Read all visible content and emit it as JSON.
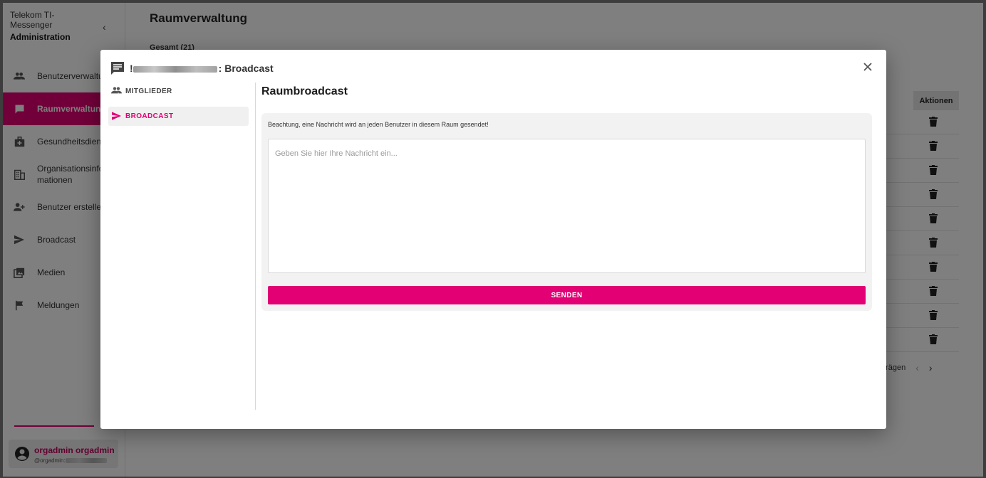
{
  "app": {
    "brand_line1": "Telekom TI-",
    "brand_line2": "Messenger",
    "brand_line3": "Administration"
  },
  "sidebar": {
    "items": [
      {
        "label": "Benutzerverwaltung",
        "icon": "people-icon",
        "active": false
      },
      {
        "label": "Raumverwaltung",
        "icon": "chat-icon",
        "active": true
      },
      {
        "label": "Gesundheitsdienste",
        "icon": "medical-bag-icon",
        "active": false
      },
      {
        "label": "Organisationsinformationen",
        "label_line1": "Organisationsinfor",
        "label_line2": "mationen",
        "icon": "building-icon",
        "active": false
      },
      {
        "label": "Benutzer erstellen",
        "icon": "person-add-icon",
        "active": false
      },
      {
        "label": "Broadcast",
        "icon": "send-icon",
        "active": false
      },
      {
        "label": "Medien",
        "icon": "media-library-icon",
        "active": false
      },
      {
        "label": "Meldungen",
        "icon": "flag-icon",
        "active": false
      }
    ]
  },
  "user": {
    "name": "orgadmin orgadmin",
    "id_prefix": "@orgadmin:"
  },
  "main": {
    "title": "Raumverwaltung",
    "total": "Gesamt (21)",
    "actions_header": "Aktionen",
    "rows": 10,
    "pager_text": "trägen",
    "prev": "‹",
    "next": "›"
  },
  "dialog": {
    "title_prefix": "!",
    "title_suffix": ": Broadcast",
    "tabs": [
      {
        "label": "MITGLIEDER",
        "icon": "people-icon",
        "active": false
      },
      {
        "label": "BROADCAST",
        "icon": "send-icon",
        "active": true
      }
    ],
    "content_title": "Raumbroadcast",
    "note": "Beachtung, eine Nachricht wird an jeden Benutzer in diesem Raum gesendet!",
    "message_placeholder": "Geben Sie hier Ihre Nachricht ein...",
    "message_value": "",
    "send_label": "SENDEN"
  },
  "colors": {
    "accent": "#e20074",
    "overlay": "rgba(0,0,0,0.5)"
  }
}
